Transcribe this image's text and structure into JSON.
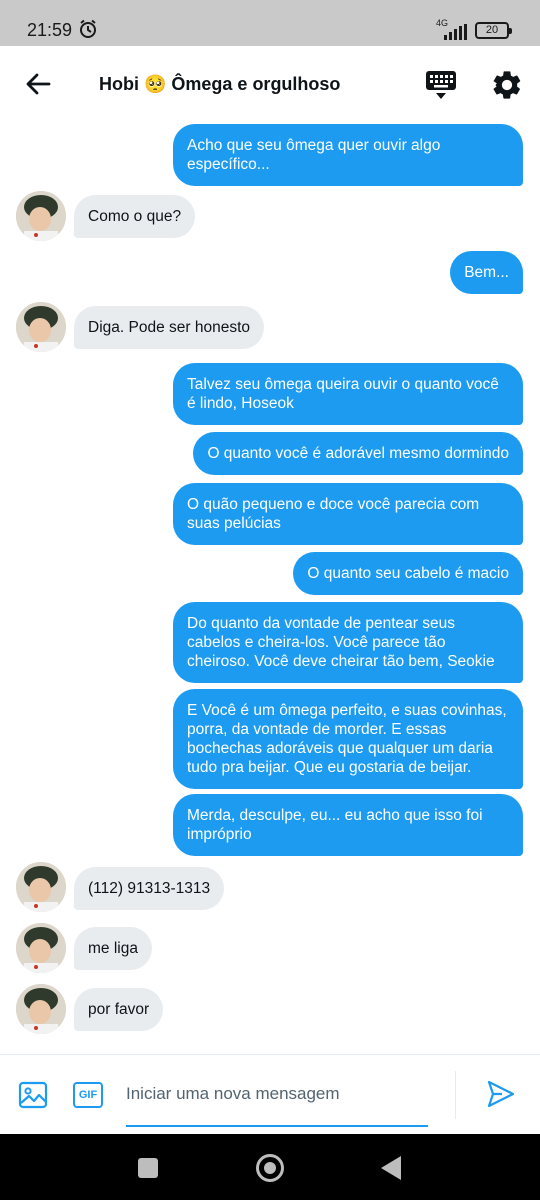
{
  "status_bar": {
    "time": "21:59",
    "network": "4G",
    "battery": "20"
  },
  "header": {
    "title": "Hobi 🥺 Ômega e orgulhoso"
  },
  "messages": [
    {
      "from": "me",
      "text": "Acho que seu ômega quer ouvir algo específico..."
    },
    {
      "from": "them",
      "text": "Como o que?"
    },
    {
      "from": "me",
      "text": "Bem..."
    },
    {
      "from": "them",
      "text": "Diga. Pode ser honesto"
    },
    {
      "from": "me",
      "text": "Talvez seu ômega queira ouvir o quanto você é lindo, Hoseok"
    },
    {
      "from": "me",
      "text": "O quanto você é adorável mesmo dormindo"
    },
    {
      "from": "me",
      "text": "O quão pequeno e doce você parecia com suas pelúcias"
    },
    {
      "from": "me",
      "text": "O quanto seu cabelo é macio"
    },
    {
      "from": "me",
      "text": "Do quanto da vontade de pentear seus cabelos e cheira-los. Você parece tão cheiroso. Você deve cheirar tão bem, Seokie"
    },
    {
      "from": "me",
      "text": "E Você é um ômega perfeito, e suas covinhas, porra, da vontade de morder. E essas bochechas adoráveis que qualquer um daria tudo pra beijar. Que eu gostaria de beijar."
    },
    {
      "from": "me",
      "text": "Merda, desculpe, eu... eu acho que isso foi impróprio"
    },
    {
      "from": "them",
      "text": "(112) 91313-1313"
    },
    {
      "from": "them",
      "text": "me liga"
    },
    {
      "from": "them",
      "text": "por favor"
    }
  ],
  "composer": {
    "placeholder": "Iniciar uma nova mensagem",
    "gif_label": "GIF"
  },
  "colors": {
    "accent": "#1d9bf0",
    "incoming_bubble": "#e9ecef",
    "status_bar": "#c9c9c9"
  },
  "icons": [
    "back-arrow-icon",
    "keyboard-icon",
    "gear-icon",
    "image-icon",
    "gif-icon",
    "send-icon",
    "alarm-clock-icon",
    "signal-icon",
    "battery-icon"
  ]
}
